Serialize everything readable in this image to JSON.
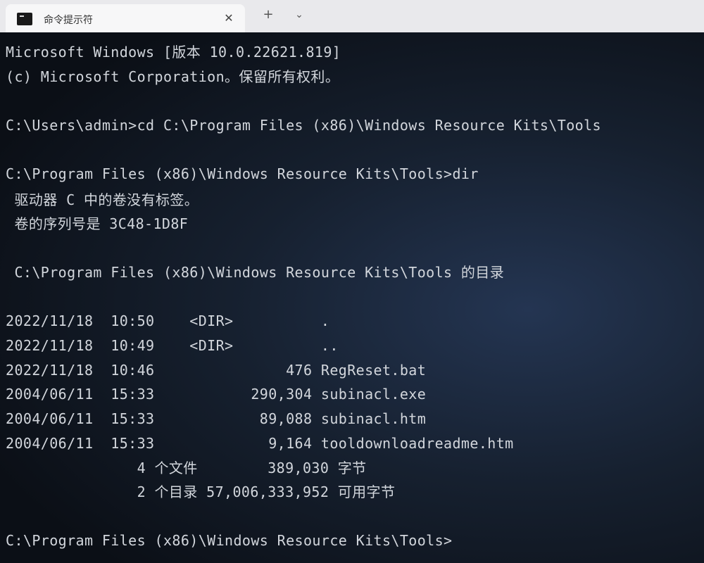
{
  "window": {
    "tab_title": "命令提示符",
    "tab_close": "✕",
    "new_tab": "+",
    "dropdown": "⌄"
  },
  "terminal": {
    "lines": [
      "Microsoft Windows [版本 10.0.22621.819]",
      "(c) Microsoft Corporation。保留所有权利。",
      "",
      "C:\\Users\\admin>cd C:\\Program Files (x86)\\Windows Resource Kits\\Tools",
      "",
      "C:\\Program Files (x86)\\Windows Resource Kits\\Tools>dir",
      " 驱动器 C 中的卷没有标签。",
      " 卷的序列号是 3C48-1D8F",
      "",
      " C:\\Program Files (x86)\\Windows Resource Kits\\Tools 的目录",
      "",
      "2022/11/18  10:50    <DIR>          .",
      "2022/11/18  10:49    <DIR>          ..",
      "2022/11/18  10:46               476 RegReset.bat",
      "2004/06/11  15:33           290,304 subinacl.exe",
      "2004/06/11  15:33            89,088 subinacl.htm",
      "2004/06/11  15:33             9,164 tooldownloadreadme.htm",
      "               4 个文件        389,030 字节",
      "               2 个目录 57,006,333,952 可用字节",
      "",
      "C:\\Program Files (x86)\\Windows Resource Kits\\Tools>"
    ]
  }
}
